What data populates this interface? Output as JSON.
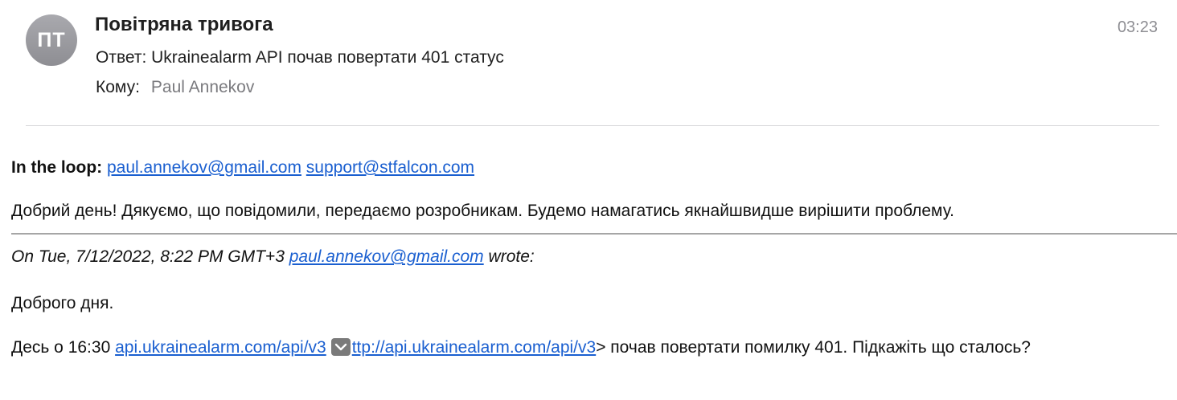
{
  "header": {
    "avatar_initials": "ПТ",
    "sender": "Повітряна тривога",
    "time": "03:23",
    "subject": "Ответ: Ukrainealarm API почав повертати 401 статус",
    "to_label": "Кому:",
    "to_value": "Paul Annekov"
  },
  "body": {
    "loop_label": "In the loop:",
    "loop_emails": [
      "paul.annekov@gmail.com",
      "support@stfalcon.com"
    ],
    "reply_text": "Добрий день! Дякуємо, що повідомили, передаємо розробникам. Будемо намагатись якнайшвидше вирішити проблему."
  },
  "quote": {
    "attribution_prefix": "On Tue, 7/12/2022, 8:22 PM GMT+3",
    "attribution_email": "paul.annekov@gmail.com",
    "attribution_suffix": "wrote:",
    "greeting": "Доброго дня.",
    "question_prefix": "Десь о 16:30",
    "link_short": "api.ukrainealarm.com/api/v3",
    "link_full": "ttp://api.ukrainealarm.com/api/v3",
    "question_suffix": "> почав повертати помилку 401. Підкажіть що сталось?"
  },
  "icons": {
    "expand_link": "chevron-down-icon"
  },
  "colors": {
    "link": "#1a5fd0",
    "avatar": "#8e8e93",
    "muted": "#7a7a7e"
  }
}
